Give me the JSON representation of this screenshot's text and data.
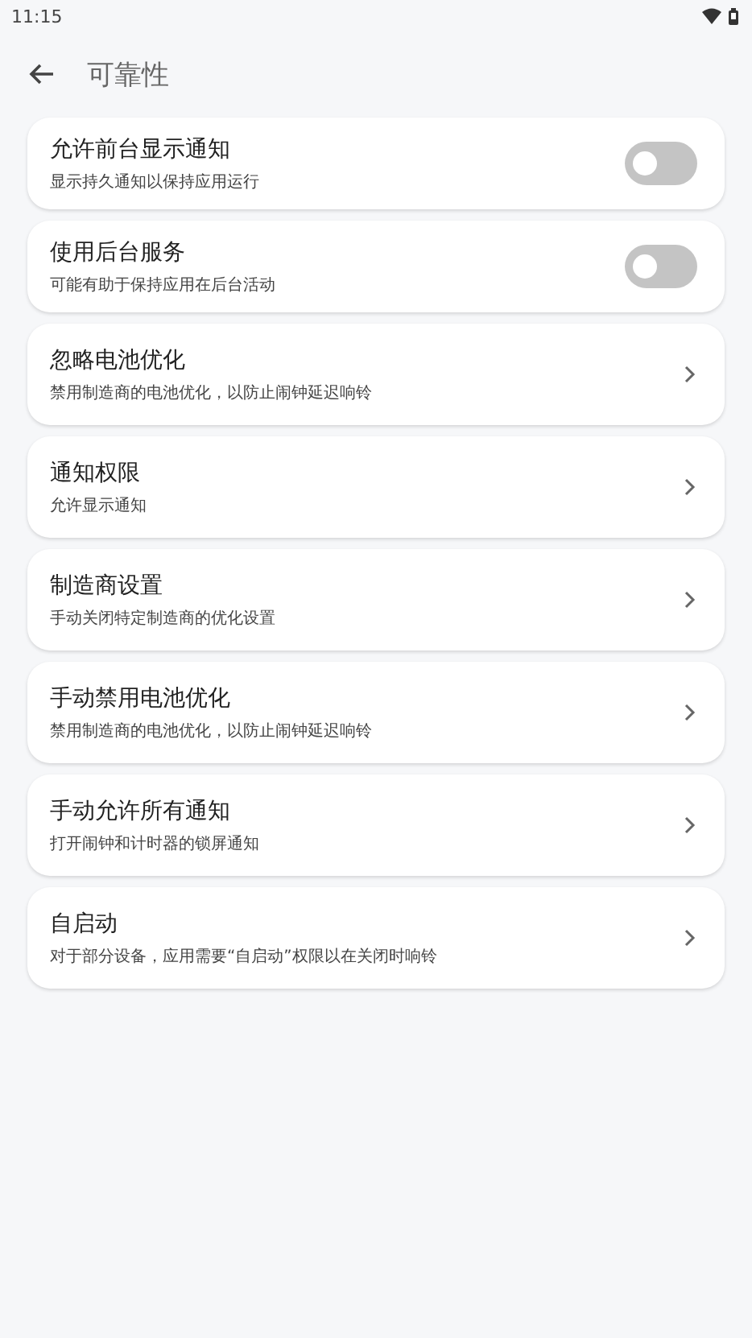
{
  "status_bar": {
    "time": "11:15"
  },
  "header": {
    "title": "可靠性"
  },
  "items": [
    {
      "kind": "toggle",
      "title": "允许前台显示通知",
      "subtitle": "显示持久通知以保持应用运行",
      "on": false
    },
    {
      "kind": "toggle",
      "title": "使用后台服务",
      "subtitle": "可能有助于保持应用在后台活动",
      "on": false
    },
    {
      "kind": "link",
      "title": "忽略电池优化",
      "subtitle": "禁用制造商的电池优化，以防止闹钟延迟响铃"
    },
    {
      "kind": "link",
      "title": "通知权限",
      "subtitle": "允许显示通知"
    },
    {
      "kind": "link",
      "title": "制造商设置",
      "subtitle": "手动关闭特定制造商的优化设置"
    },
    {
      "kind": "link",
      "title": "手动禁用电池优化",
      "subtitle": "禁用制造商的电池优化，以防止闹钟延迟响铃"
    },
    {
      "kind": "link",
      "title": "手动允许所有通知",
      "subtitle": "打开闹钟和计时器的锁屏通知"
    },
    {
      "kind": "link",
      "title": "自启动",
      "subtitle": "对于部分设备，应用需要“自启动”权限以在关闭时响铃"
    }
  ]
}
